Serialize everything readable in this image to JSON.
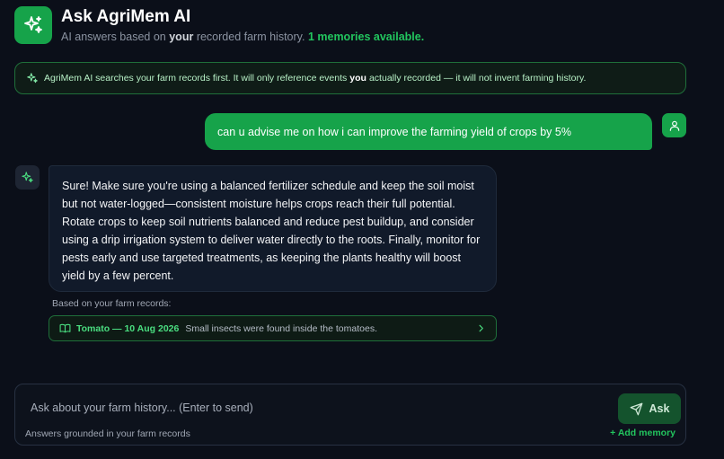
{
  "header": {
    "title": "Ask AgriMem AI",
    "subtitle_prefix": "AI answers based on",
    "subtitle_strong": "your",
    "subtitle_middle": "recorded farm history.",
    "memories_count": "1 memories available.",
    "logo_icon": "sparkles-icon",
    "accent_color": "#16a34a"
  },
  "notice": {
    "icon": "sparkles-icon",
    "text_before": "AgriMem AI searches your farm records first. It will only reference events",
    "text_strong": "you",
    "text_after": "actually recorded — it will not invent farming history."
  },
  "conversation": {
    "user_message": "can u advise me on how i can improve the farming yield of crops by 5%",
    "user_avatar_icon": "user-icon",
    "ai_avatar_icon": "sparkles-icon",
    "ai_message": "Sure! Make sure you're using a balanced fertilizer schedule and keep the soil moist but not water-logged—consistent moisture helps crops reach their full potential. Rotate crops to keep soil nutrients balanced and reduce pest buildup, and consider using a drip irrigation system to deliver water directly to the roots. Finally, monitor for pests early and use targeted treatments, as keeping the plants healthy will boost yield by a few percent.",
    "sources_label": "Based on your farm records:",
    "sources": [
      {
        "icon": "book-open-icon",
        "title": "Tomato — 10 Aug 2026",
        "description": "Small insects were found inside the tomatoes."
      }
    ]
  },
  "composer": {
    "placeholder": "Ask about your farm history... (Enter to send)",
    "value": "",
    "ask_label": "Ask",
    "ask_icon": "send-icon",
    "footer_note": "Answers grounded in your farm records",
    "add_memory_label": "+ Add memory"
  }
}
